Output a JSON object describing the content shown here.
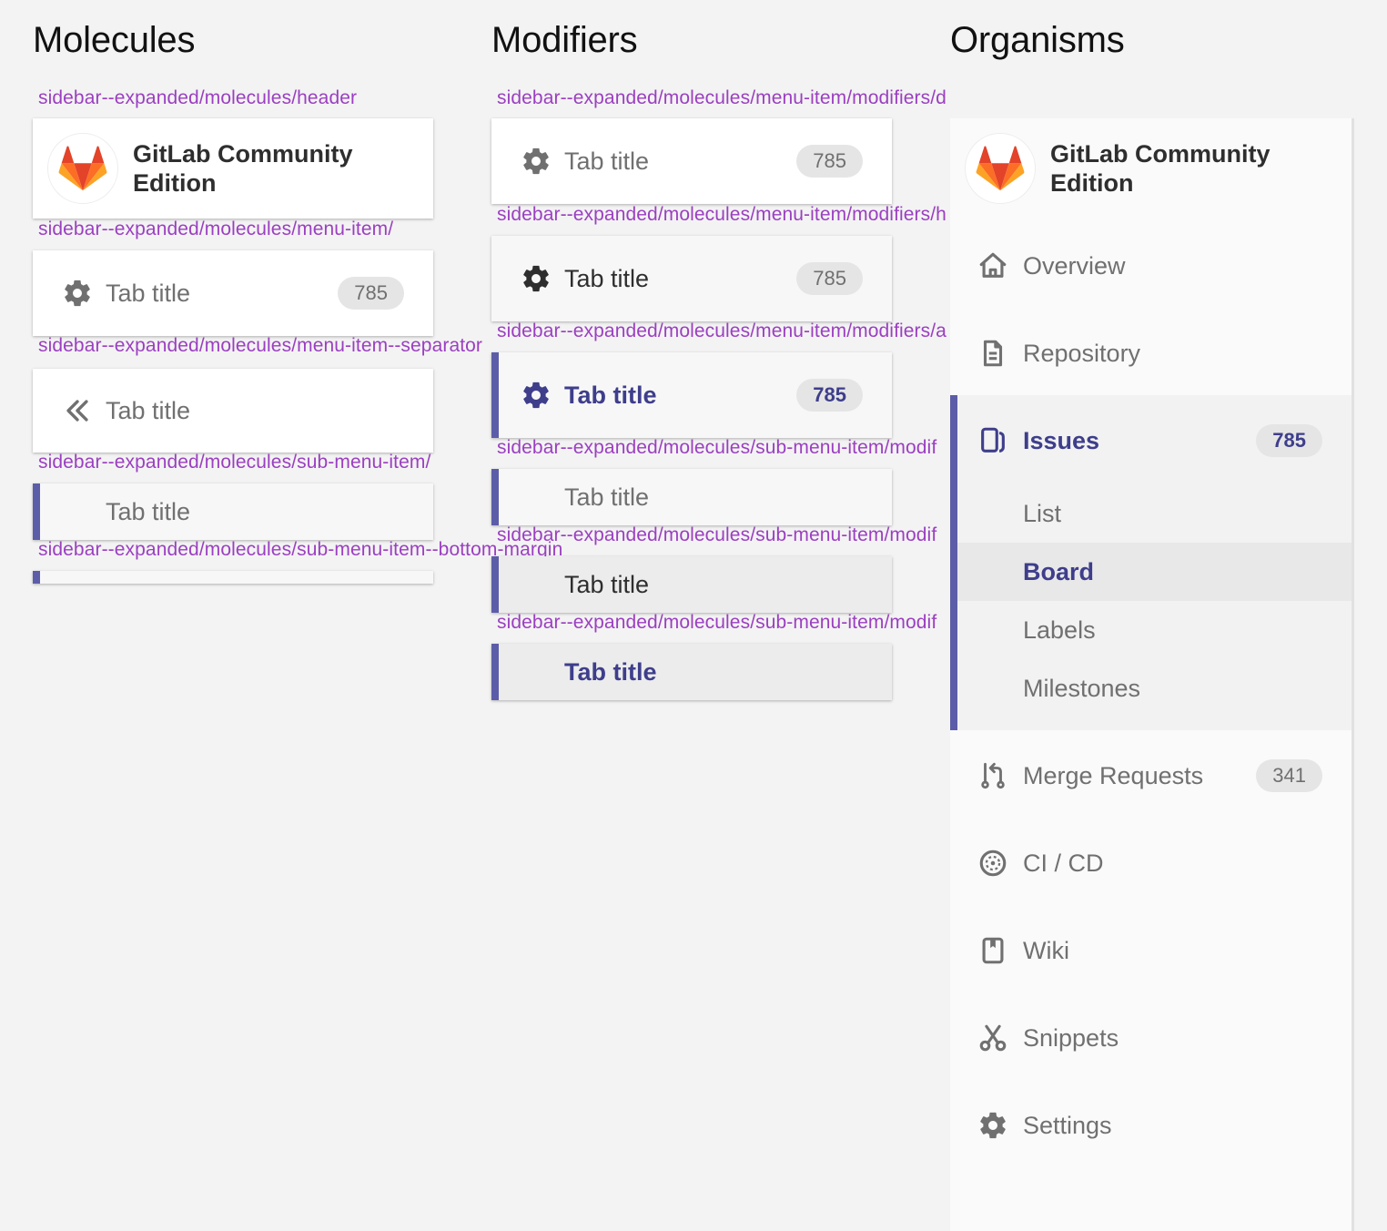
{
  "headings": {
    "molecules": "Molecules",
    "modifiers": "Modifiers",
    "organisms": "Organisms"
  },
  "molecules": {
    "header_label": "sidebar--expanded/molecules/header",
    "brand": [
      "GitLab Community",
      "Edition"
    ],
    "menu_item_label": "sidebar--expanded/molecules/menu-item/",
    "menu_item_title": "Tab title",
    "menu_item_count": "785",
    "separator_label": "sidebar--expanded/molecules/menu-item--separator",
    "separator_title": "Tab title",
    "sub_menu_label": "sidebar--expanded/molecules/sub-menu-item/",
    "sub_menu_title": "Tab title",
    "bottom_margin_label": "sidebar--expanded/molecules/sub-menu-item--bottom-margin"
  },
  "modifiers": {
    "items": [
      {
        "label": "sidebar--expanded/molecules/menu-item/modifiers/d",
        "title": "Tab title",
        "count": "785"
      },
      {
        "label": "sidebar--expanded/molecules/menu-item/modifiers/h",
        "title": "Tab title",
        "count": "785"
      },
      {
        "label": "sidebar--expanded/molecules/menu-item/modifiers/a",
        "title": "Tab title",
        "count": "785"
      },
      {
        "label": "sidebar--expanded/molecules/sub-menu-item/modif",
        "title": "Tab title"
      },
      {
        "label": "sidebar--expanded/molecules/sub-menu-item/modif",
        "title": "Tab title"
      },
      {
        "label": "sidebar--expanded/molecules/sub-menu-item/modif",
        "title": "Tab title"
      }
    ]
  },
  "sidebar": {
    "brand": [
      "GitLab Community",
      "Edition"
    ],
    "items": [
      {
        "label": "Overview",
        "icon": "home-icon"
      },
      {
        "label": "Repository",
        "icon": "document-icon"
      },
      {
        "label": "Issues",
        "icon": "issues-icon",
        "count": "785"
      },
      {
        "label": "Merge Requests",
        "icon": "merge-request-icon",
        "count": "341"
      },
      {
        "label": "CI / CD",
        "icon": "rocket-icon"
      },
      {
        "label": "Wiki",
        "icon": "book-icon"
      },
      {
        "label": "Snippets",
        "icon": "scissors-icon"
      },
      {
        "label": "Settings",
        "icon": "gear-icon"
      }
    ],
    "sub_items": [
      "List",
      "Board",
      "Labels",
      "Milestones"
    ]
  },
  "colors": {
    "accent": "#5c5da8",
    "active_text": "#3e3e8c",
    "muted_text": "#707070",
    "label_purple": "#9b3fc1"
  }
}
